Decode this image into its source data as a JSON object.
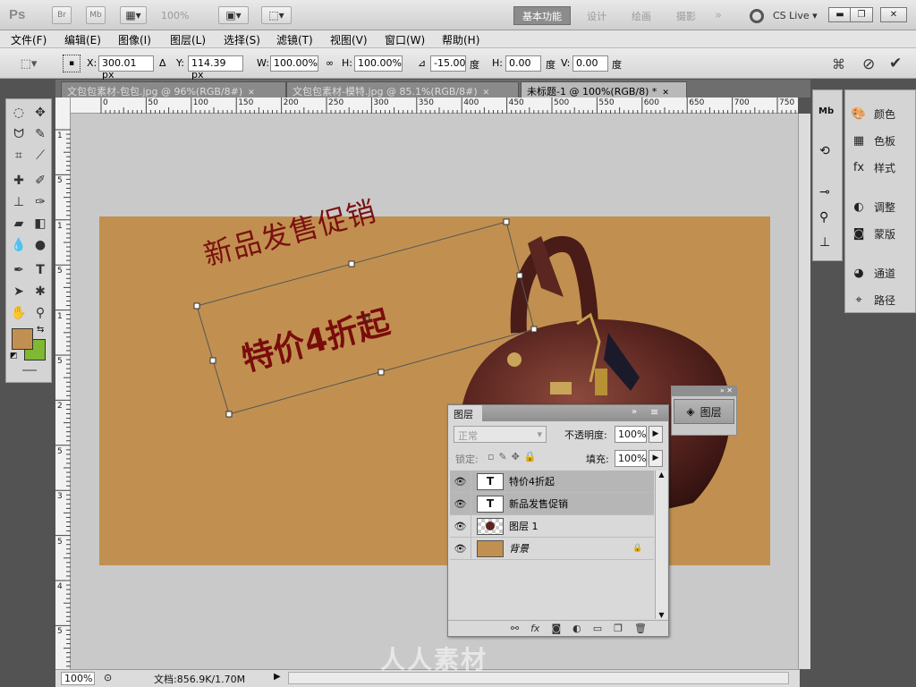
{
  "app": {
    "logo": "Ps",
    "zoom": "100%",
    "bridge": "Br",
    "minibridge": "Mb",
    "workspaces": [
      "基本功能",
      "设计",
      "绘画",
      "摄影"
    ],
    "more": "»",
    "cslive": "CS Live"
  },
  "menu": [
    "文件(F)",
    "编辑(E)",
    "图像(I)",
    "图层(L)",
    "选择(S)",
    "滤镜(T)",
    "视图(V)",
    "窗口(W)",
    "帮助(H)"
  ],
  "options": {
    "x_label": "X:",
    "x": "300.01 px",
    "y_label": "Y:",
    "y": "114.39 px",
    "w_label": "W:",
    "w": "100.00%",
    "h_label": "H:",
    "h": "100.00%",
    "angle": "-15.00",
    "angle_unit": "度",
    "hskew_label": "H:",
    "hskew": "0.00",
    "hskew_unit": "度",
    "vskew_label": "V:",
    "vskew": "0.00",
    "vskew_unit": "度"
  },
  "tabs": [
    {
      "label": "文包包素材-包包.jpg @ 96%(RGB/8#)"
    },
    {
      "label": "文包包素材-模特.jpg @ 85.1%(RGB/8#)"
    },
    {
      "label": "未标题-1 @ 100%(RGB/8) *"
    }
  ],
  "ruler_h": [
    "0",
    "50",
    "100",
    "150",
    "200",
    "250",
    "300",
    "350",
    "400",
    "450",
    "500",
    "550",
    "600",
    "650",
    "700",
    "750"
  ],
  "ruler_v": [
    "1",
    "5",
    "1",
    "5",
    "1",
    "5",
    "2",
    "5",
    "3",
    "5",
    "4",
    "5"
  ],
  "canvas": {
    "text_line1": "新品发售促销",
    "text_line2": "特价4折起",
    "bg_color": "#c19050",
    "text_color": "#7a1010"
  },
  "swatches": {
    "foreground": "#c19050",
    "background": "#7fb832"
  },
  "dock": [
    {
      "label": "颜色",
      "icon": "palette-icon"
    },
    {
      "label": "色板",
      "icon": "grid-icon"
    },
    {
      "label": "样式",
      "icon": "fx-icon"
    },
    {
      "label": "调整",
      "icon": "adjust-icon"
    },
    {
      "label": "蒙版",
      "icon": "mask-icon"
    },
    {
      "label": "通道",
      "icon": "channels-icon"
    },
    {
      "label": "路径",
      "icon": "paths-icon"
    }
  ],
  "mini_layer": {
    "label": "图层"
  },
  "layers_panel": {
    "title": "图层",
    "blend_mode": "正常",
    "opacity_label": "不透明度:",
    "opacity": "100%",
    "lock_label": "锁定:",
    "fill_label": "填充:",
    "fill": "100%",
    "layers": [
      {
        "name": "特价4折起",
        "thumb": "T"
      },
      {
        "name": "新品发售促销",
        "thumb": "T"
      },
      {
        "name": "图层 1",
        "thumb": ""
      },
      {
        "name": "背景",
        "thumb": ""
      }
    ],
    "bottom_icons": [
      "link-icon",
      "fx-icon",
      "mask-icon",
      "adjustment-icon",
      "folder-icon",
      "new-layer-icon",
      "trash-icon"
    ]
  },
  "status": {
    "zoom": "100%",
    "doc": "文档:856.9K/1.70M"
  },
  "watermark": "人人素材"
}
